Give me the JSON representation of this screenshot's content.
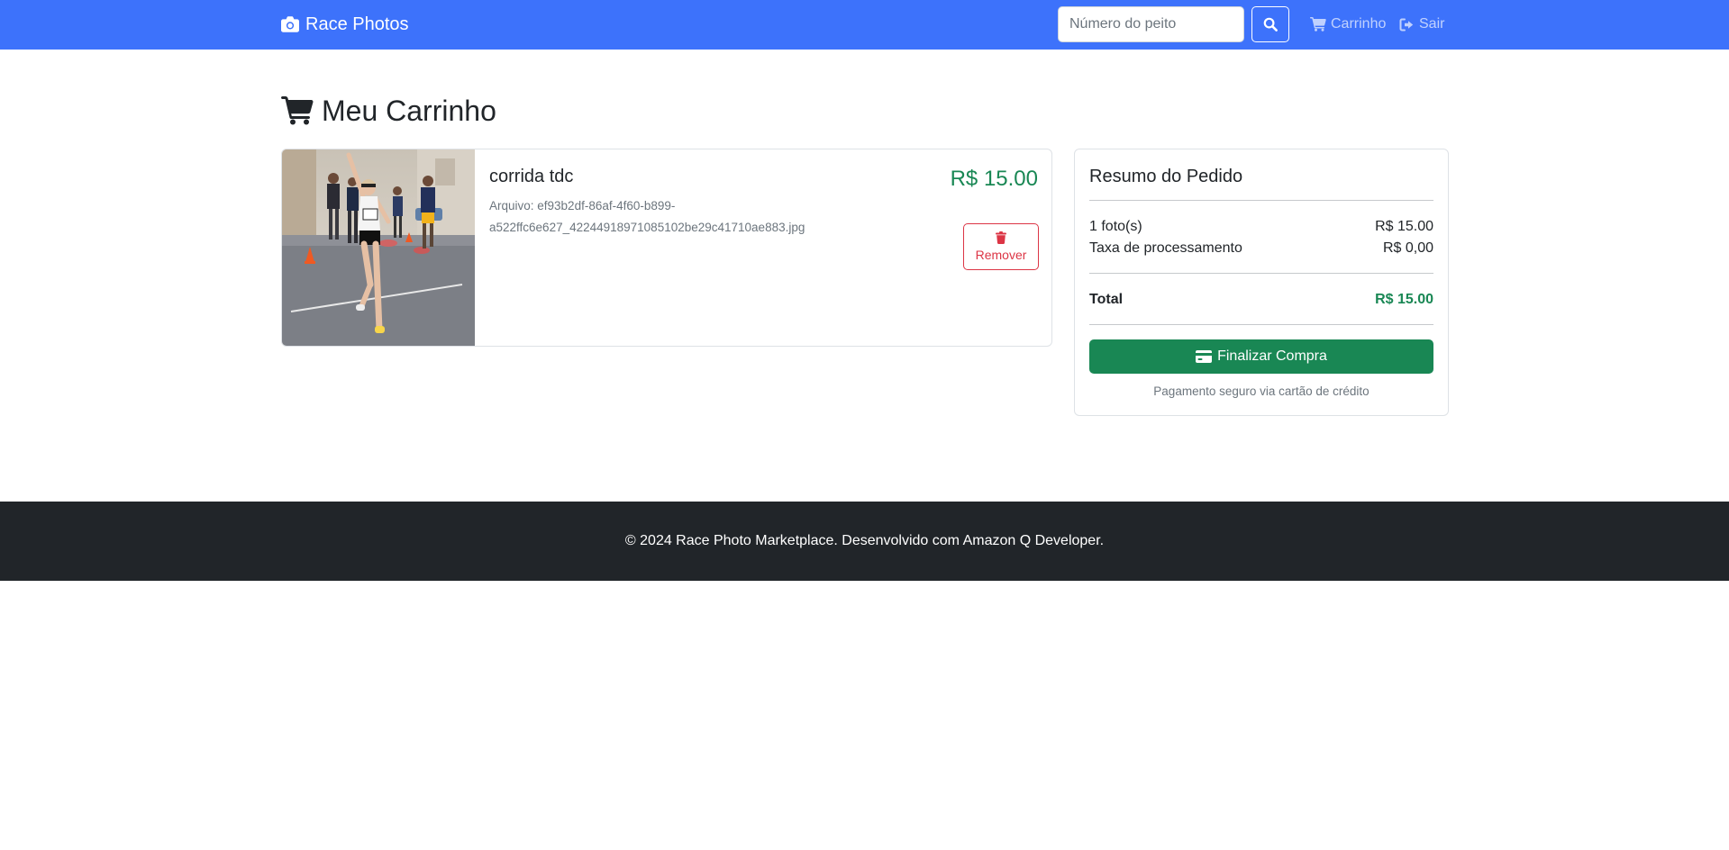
{
  "colors": {
    "navbar": "#3d72fb",
    "accent_success": "#198754",
    "danger": "#dc3545",
    "footer": "#212529",
    "muted": "#6c757d"
  },
  "navbar": {
    "brand_icon": "camera-icon",
    "brand": "Race Photos",
    "search": {
      "placeholder": "Número do peito",
      "value": "",
      "icon": "search-icon"
    },
    "links": [
      {
        "icon": "cart-icon",
        "label": "Carrinho"
      },
      {
        "icon": "sign-out-icon",
        "label": "Sair"
      }
    ]
  },
  "page": {
    "title_icon": "cart-icon",
    "title": "Meu Carrinho"
  },
  "cart": {
    "items": [
      {
        "title": "corrida tdc",
        "file": "Arquivo: ef93b2df-86af-4f60-b899-a522ffc6e627_42244918971085102be29c41710ae883.jpg",
        "price": "R$ 15.00",
        "remove_label": "Remover",
        "remove_icon": "trash-icon",
        "photo_description_icon": "runner-photo"
      }
    ]
  },
  "summary": {
    "title": "Resumo do Pedido",
    "photos_label": "1 foto(s)",
    "photos_value": "R$ 15.00",
    "fee_label": "Taxa de processamento",
    "fee_value": "R$ 0,00",
    "total_label": "Total",
    "total_value": "R$ 15.00",
    "checkout_label": "Finalizar Compra",
    "checkout_icon": "credit-card-icon",
    "secure_note": "Pagamento seguro via cartão de crédito"
  },
  "footer": {
    "text": "© 2024 Race Photo Marketplace. Desenvolvido com Amazon Q Developer."
  }
}
